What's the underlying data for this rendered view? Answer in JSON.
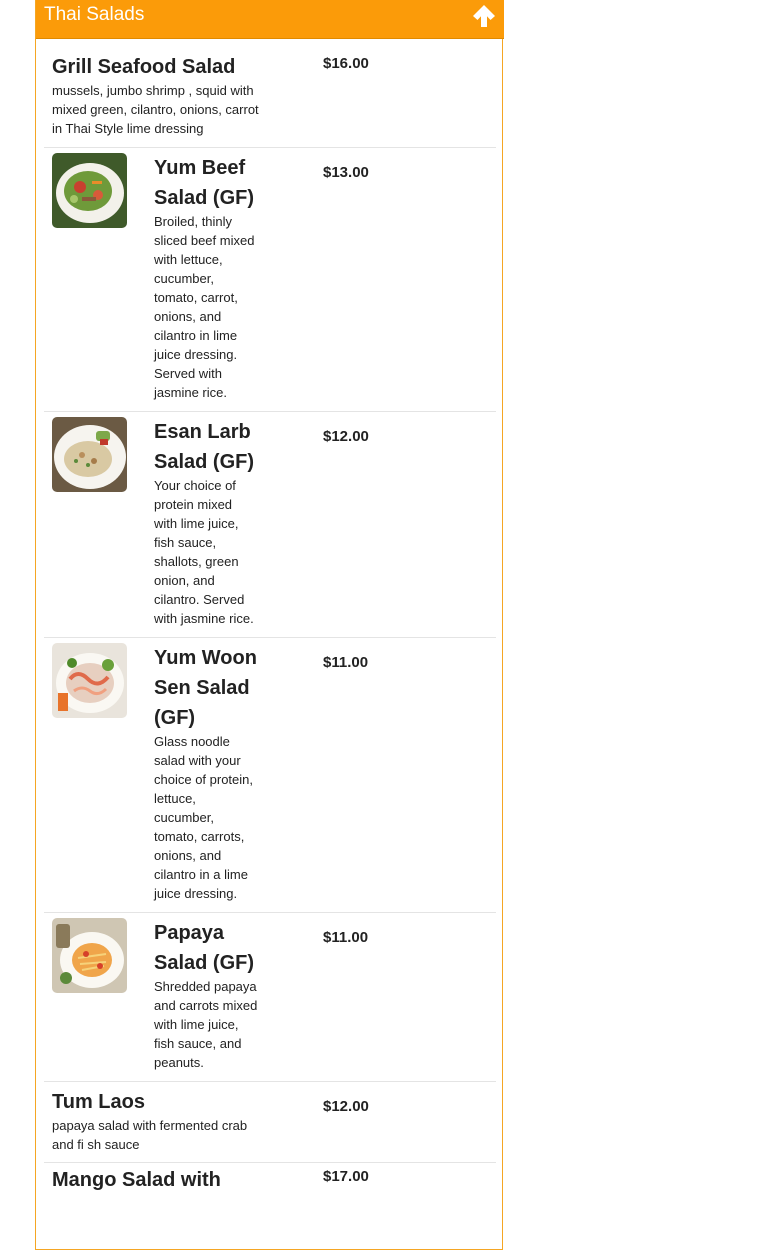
{
  "section": {
    "title": "Thai Salads",
    "header_color": "#fb9b09",
    "collapse_icon": "arrow-up-icon"
  },
  "items": [
    {
      "name": "Grill Seafood Salad",
      "desc": "mussels, jumbo shrimp , squid with mixed green, cilantro, onions, carrot in Thai Style lime dressing",
      "price": "$16.00"
    },
    {
      "name": "Yum Beef Salad (GF)",
      "desc": "Broiled, thinly sliced beef mixed with lettuce, cucumber, tomato, carrot, onions, and cilantro in lime juice dressing. Served with jasmine rice.",
      "price": "$13.00",
      "image": "beef-salad-photo"
    },
    {
      "name": "Esan Larb Salad (GF)",
      "desc": "Your choice of protein mixed with lime juice, fish sauce, shallots, green onion, and cilantro. Served with jasmine rice.",
      "price": "$12.00",
      "image": "larb-salad-photo"
    },
    {
      "name": "Yum Woon Sen Salad (GF)",
      "desc": "Glass noodle salad with your choice of protein, lettuce, cucumber, tomato, carrots, onions, and cilantro in a lime juice dressing.",
      "price": "$11.00",
      "image": "woon-sen-salad-photo"
    },
    {
      "name": "Papaya Salad (GF)",
      "desc": "Shredded papaya and carrots mixed with lime juice, fish sauce, and peanuts.",
      "price": "$11.00",
      "image": "papaya-salad-photo"
    },
    {
      "name": "Tum Laos",
      "desc": "papaya salad with fermented crab and fi sh sauce",
      "price": "$12.00"
    },
    {
      "name": "Mango Salad with",
      "desc": "",
      "price": "$17.00"
    }
  ]
}
